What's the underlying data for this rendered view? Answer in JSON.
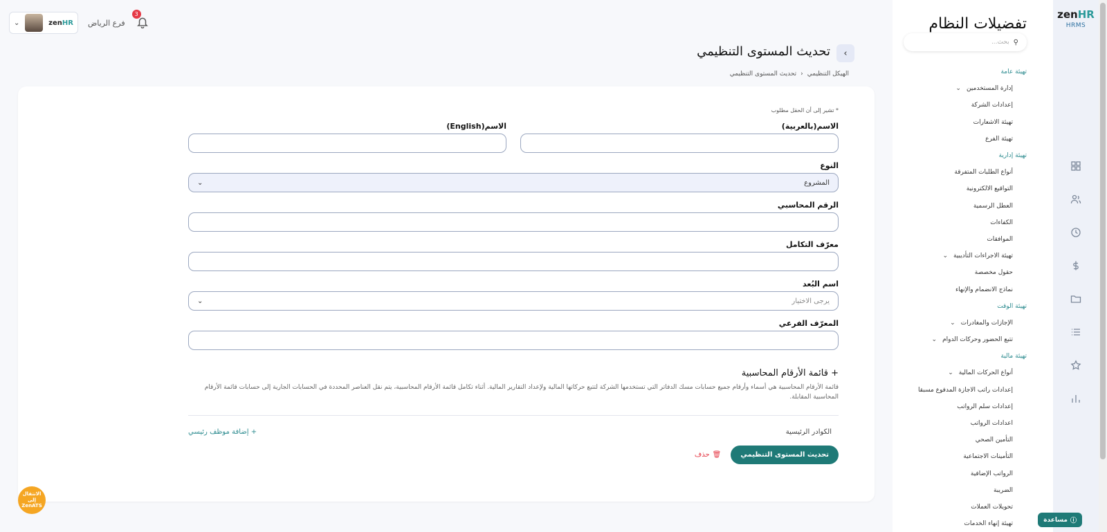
{
  "brand": {
    "logo_main": "zen",
    "logo_accent": "HR",
    "logo_sub": "HRMS"
  },
  "sidebar": {
    "title": "تفضيلات النظام",
    "search_placeholder": "بحث...",
    "items": [
      {
        "label": "تهيئة عامة",
        "type": "section"
      },
      {
        "label": "إدارة المستخدمين",
        "type": "item",
        "expandable": true
      },
      {
        "label": "إعدادات الشركة",
        "type": "item"
      },
      {
        "label": "تهيئة الاشعارات",
        "type": "item"
      },
      {
        "label": "تهيئة الفرع",
        "type": "item"
      },
      {
        "label": "تهيئة إدارية",
        "type": "section"
      },
      {
        "label": "أنواع الطلبات المتفرقة",
        "type": "item"
      },
      {
        "label": "التواقيع الالكترونية",
        "type": "item"
      },
      {
        "label": "العطل الرسمية",
        "type": "item"
      },
      {
        "label": "الكفاءات",
        "type": "item"
      },
      {
        "label": "الموافقات",
        "type": "item"
      },
      {
        "label": "تهيئة الاجراءات التأديبية",
        "type": "item",
        "expandable": true
      },
      {
        "label": "حقول مخصصة",
        "type": "item"
      },
      {
        "label": "نماذج الانضمام والإنهاء",
        "type": "item"
      },
      {
        "label": "تهيئة الوقت",
        "type": "section"
      },
      {
        "label": "الإجازات والمغادرات",
        "type": "item",
        "expandable": true
      },
      {
        "label": "تتبع الحضور وحركات الدوام",
        "type": "item",
        "expandable": true
      },
      {
        "label": "تهيئة مالية",
        "type": "section"
      },
      {
        "label": "أنواع الحركات المالية",
        "type": "item",
        "expandable": true
      },
      {
        "label": "إعدادات راتب الاجازة المدفوع مسبقا",
        "type": "item"
      },
      {
        "label": "إعدادات سلم الرواتب",
        "type": "item"
      },
      {
        "label": "اعدادات الرواتب",
        "type": "item"
      },
      {
        "label": "التأمين الصحي",
        "type": "item"
      },
      {
        "label": "التأمينات الاجتماعية",
        "type": "item"
      },
      {
        "label": "الرواتب الإضافية",
        "type": "item"
      },
      {
        "label": "الضريبة",
        "type": "item"
      },
      {
        "label": "تحويلات العملات",
        "type": "item"
      },
      {
        "label": "تهيئة إنهاء الخدمات",
        "type": "item"
      }
    ]
  },
  "rail_icons": [
    "grid-icon",
    "users-icon",
    "clock-icon",
    "dollar-icon",
    "folder-icon",
    "list-icon",
    "star-icon",
    "chart-icon"
  ],
  "topbar": {
    "branch": "فرع الرياض",
    "notifications": "3",
    "mini_logo_main": "zen",
    "mini_logo_accent": "HR"
  },
  "page": {
    "title": "تحديث المستوى التنظيمي",
    "breadcrumb": [
      "الهيكل التنظيمي",
      "تحديث المستوى التنظيمي"
    ]
  },
  "form": {
    "required_note": "* تشير إلى أن الحقل مطلوب",
    "name_ar_label": "الاسم(بالعربية)",
    "name_en_label": "الاسم(English)",
    "type_label": "النوع",
    "type_value": "المشروع",
    "account_number_label": "الرقم المحاسبي",
    "integration_id_label": "معرّف التكامل",
    "dimension_label": "اسم البُعد",
    "dimension_placeholder": "يرجى الاختيار",
    "sub_id_label": "المعرّف الفرعي",
    "chart_accounts_title": "+ قائمة الأرقام المحاسبية",
    "chart_accounts_desc": "قائمة الأرقام المحاسبية هي أسماء وأرقام جميع حسابات مسك الدفاتر التي تستخدمها الشركة لتتبع حركاتها المالية ولإعداد التقارير المالية. أثناء تكامل قائمة الأرقام المحاسبية، يتم نقل العناصر المحددة في الحسابات الجارية إلى حسابات قائمة الأرقام المحاسبية المقابلة.",
    "key_staff_label": "الكوادر الرئيسية",
    "add_key_staff": "+ إضافة موظف رئيسي",
    "submit": "تحديث المستوى التنظيمي",
    "delete": "حذف"
  },
  "zenats": {
    "line1": "الانتقال إلى",
    "line2": "ZenATS"
  },
  "help": "مساعدة",
  "colors": {
    "accent": "#1f7a77",
    "section": "#2a8a8e",
    "danger": "#e53946",
    "ats": "#f5a623"
  }
}
